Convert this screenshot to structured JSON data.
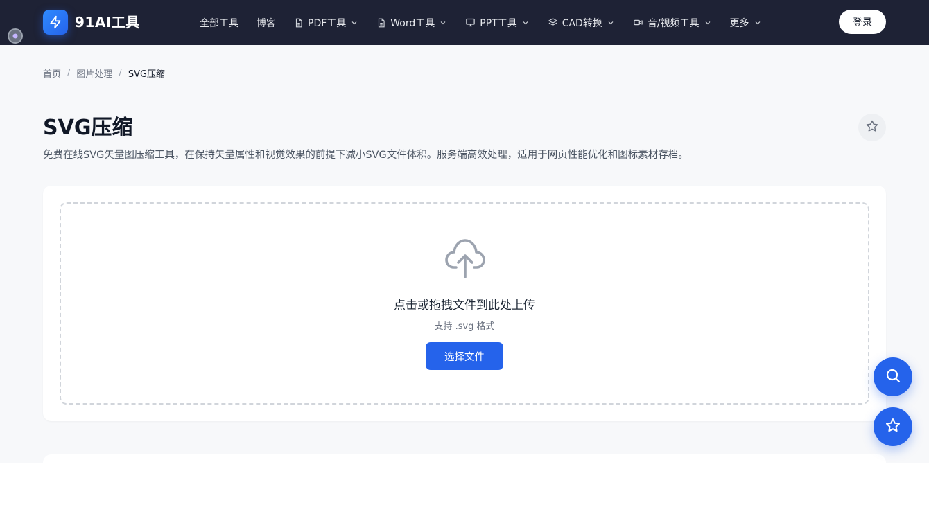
{
  "header": {
    "logo_text": "91AI工具",
    "login_label": "登录",
    "nav": [
      {
        "label": "全部工具"
      },
      {
        "label": "博客"
      },
      {
        "label": "PDF工具",
        "icon": "document-icon",
        "dropdown": true
      },
      {
        "label": "Word工具",
        "icon": "document-icon",
        "dropdown": true
      },
      {
        "label": "PPT工具",
        "icon": "presentation-icon",
        "dropdown": true
      },
      {
        "label": "CAD转换",
        "icon": "layers-icon",
        "dropdown": true
      },
      {
        "label": "音/视频工具",
        "icon": "video-icon",
        "dropdown": true
      },
      {
        "label": "更多",
        "dropdown": true
      }
    ]
  },
  "breadcrumb": {
    "home": "首页",
    "category": "图片处理",
    "current": "SVG压缩"
  },
  "page": {
    "title": "SVG压缩",
    "description": "免费在线SVG矢量图压缩工具，在保持矢量属性和视觉效果的前提下减小SVG文件体积。服务端高效处理，适用于网页性能优化和图标素材存档。"
  },
  "upload": {
    "title": "点击或拖拽文件到此处上传",
    "subtitle": "支持 .svg 格式",
    "button_label": "选择文件"
  },
  "colors": {
    "header_bg": "#1e2235",
    "accent": "#2563eb",
    "page_bg": "#f7f8fa"
  }
}
